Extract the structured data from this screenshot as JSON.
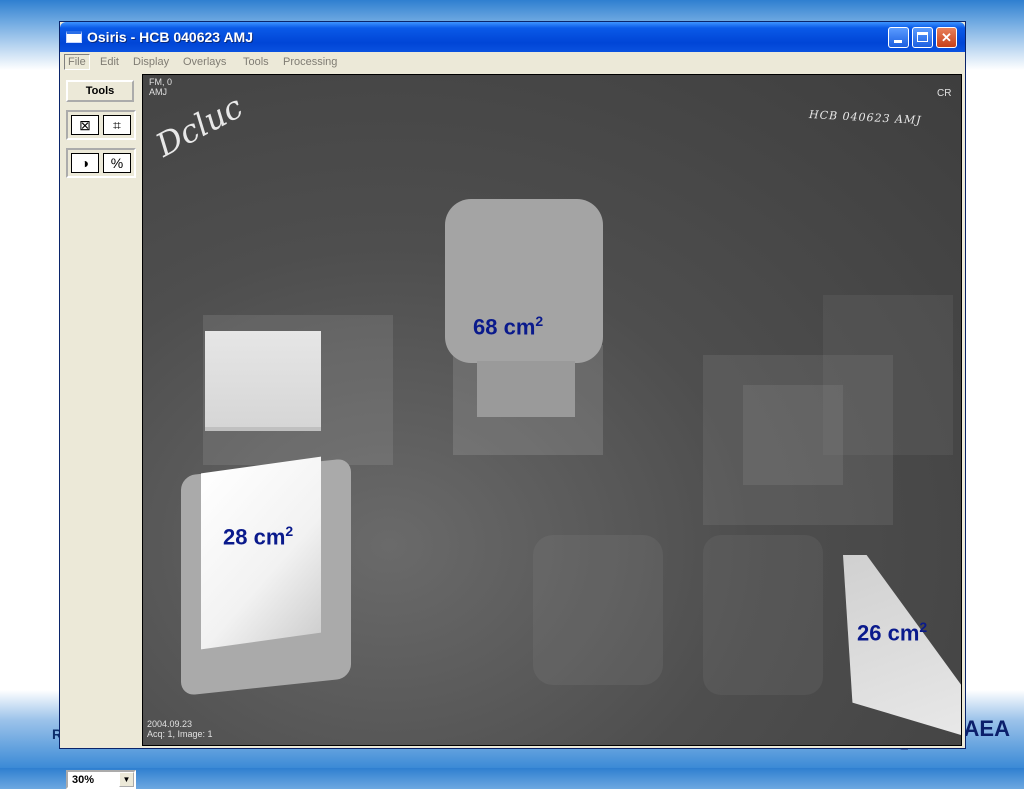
{
  "window": {
    "title": "Osiris - HCB 040623 AMJ",
    "controls": {
      "minimize": "minimize",
      "maximize": "maximize",
      "close": "✕"
    }
  },
  "menu": {
    "items": [
      "File",
      "Edit",
      "Display",
      "Overlays",
      "Tools",
      "Processing"
    ]
  },
  "toolpanel": {
    "tools_label": "Tools",
    "icons": [
      "fit-window-icon",
      "fit-image-icon",
      "contrast-icon",
      "percent-zoom-icon"
    ],
    "icon_glyphs": [
      "⊠",
      "⌗",
      "◑",
      "%"
    ],
    "zoom_value": "30%",
    "zoom_arrow": "▼"
  },
  "image": {
    "top_left_line1": "FM, 0",
    "top_left_line2": "AMJ",
    "top_right": "CR",
    "handwriting_left": "Dcluc",
    "handwriting_right": "HCB 040623 AMJ",
    "bottom_left_line1": "2004.09.23",
    "bottom_left_line2": "Acq: 1, Image: 1",
    "labels": [
      {
        "value": "68 cm",
        "sup": "2"
      },
      {
        "value": "28 cm",
        "sup": "2"
      },
      {
        "value": "26 cm",
        "sup": "2"
      }
    ]
  },
  "slide": {
    "footer_left": "R",
    "footer_right": "AEA"
  },
  "colors": {
    "titlebar": "#0a5ae8",
    "label_text": "#0a1a8c",
    "film_background": "#4b4b4b"
  }
}
